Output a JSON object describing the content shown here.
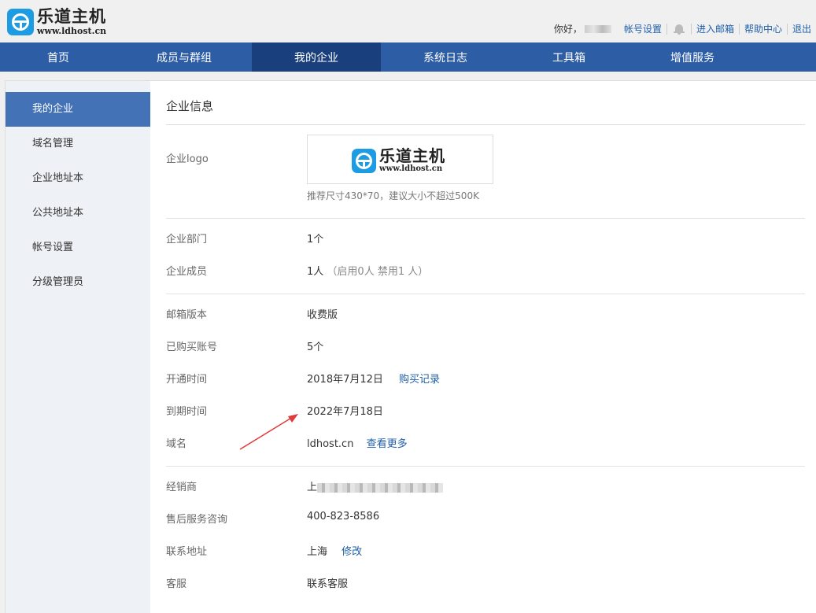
{
  "header": {
    "logo_cn": "乐道主机",
    "logo_en": "www.ldhost.cn",
    "greeting": "你好，",
    "links": {
      "account_settings": "帐号设置",
      "enter_mailbox": "进入邮箱",
      "help_center": "帮助中心",
      "logout": "退出"
    }
  },
  "nav": {
    "items": [
      "首页",
      "成员与群组",
      "我的企业",
      "系统日志",
      "工具箱",
      "增值服务"
    ],
    "active": "我的企业"
  },
  "sidebar": {
    "items": [
      "我的企业",
      "域名管理",
      "企业地址本",
      "公共地址本",
      "帐号设置",
      "分级管理员"
    ]
  },
  "content": {
    "title": "企业信息",
    "logo_label": "企业logo",
    "logo_hint": "推荐尺寸430*70，建议大小不超过500K",
    "departments": {
      "label": "企业部门",
      "value": "1个"
    },
    "members": {
      "label": "企业成员",
      "value": "1人",
      "detail": "（启用0人 禁用1 人）"
    },
    "edition": {
      "label": "邮箱版本",
      "value": "收费版"
    },
    "accounts": {
      "label": "已购买账号",
      "value": "5个"
    },
    "open_date": {
      "label": "开通时间",
      "value": "2018年7月12日",
      "link": "购买记录"
    },
    "expire_date": {
      "label": "到期时间",
      "value": "2022年7月18日"
    },
    "domain": {
      "label": "域名",
      "value": "ldhost.cn",
      "link": "查看更多"
    },
    "reseller": {
      "label": "经销商",
      "value_prefix": "上"
    },
    "support_phone": {
      "label": "售后服务咨询",
      "value": "400-823-8586"
    },
    "address": {
      "label": "联系地址",
      "value": "上海",
      "link": "修改"
    },
    "service": {
      "label": "客服",
      "link": "联系客服"
    }
  },
  "colors": {
    "nav_bg": "#2d5da5",
    "nav_active": "#1a3f7d",
    "sidebar_active": "#4372b6",
    "link": "#1f5fa8",
    "arrow": "#e03a3a"
  }
}
